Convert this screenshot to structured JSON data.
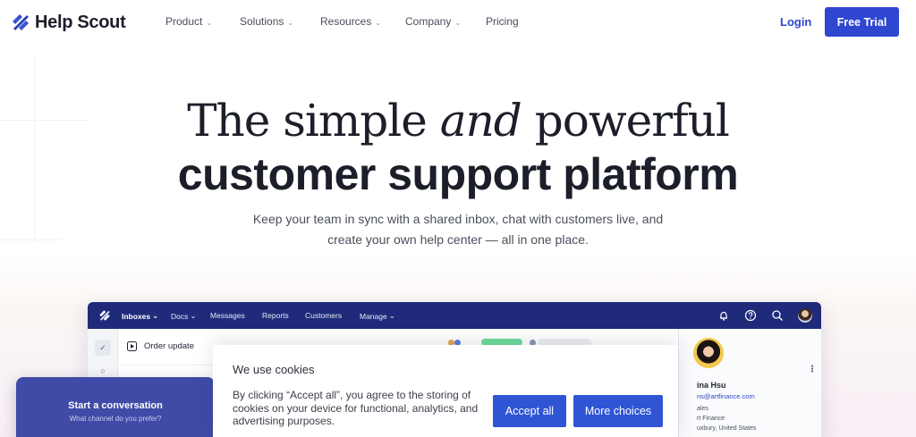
{
  "brand": {
    "name": "Help Scout",
    "accent": "#2f46d1",
    "nav_bar_color": "#1f2b7a"
  },
  "nav": {
    "items": [
      {
        "label": "Product",
        "has_dropdown": true
      },
      {
        "label": "Solutions",
        "has_dropdown": true
      },
      {
        "label": "Resources",
        "has_dropdown": true
      },
      {
        "label": "Company",
        "has_dropdown": true
      },
      {
        "label": "Pricing",
        "has_dropdown": false
      }
    ],
    "login_label": "Login",
    "cta_label": "Free Trial",
    "dropdown_icon": "chevron-down-icon"
  },
  "hero": {
    "line1_pre": "The simple ",
    "line1_em": "and",
    "line1_post": " powerful",
    "line2": "customer support platform",
    "subtitle": "Keep your team in sync with a shared inbox, chat with customers live, and create your own help center — all in one place."
  },
  "app": {
    "nav": [
      {
        "label": "Inboxes",
        "has_dropdown": true
      },
      {
        "label": "Docs",
        "has_dropdown": true
      },
      {
        "label": "Messages",
        "has_dropdown": false
      },
      {
        "label": "Reports",
        "has_dropdown": false
      },
      {
        "label": "Customers",
        "has_dropdown": false
      },
      {
        "label": "Manage",
        "has_dropdown": true
      }
    ],
    "icons": [
      "bell-icon",
      "help-icon",
      "search-icon",
      "user-avatar"
    ],
    "sidebar_icons": [
      "check-icon",
      "chat-bubble-icon"
    ],
    "conversation_title": "Order update",
    "profile": {
      "name": "ina Hsu",
      "email": "ns@artfinance.com",
      "lines": [
        "ales",
        "rt Finance",
        "uxbury, United States"
      ],
      "menu_icon": "more-vertical-icon"
    }
  },
  "chat": {
    "title": "Start a conversation",
    "subtitle": "What channel do you prefer?"
  },
  "cookie": {
    "title": "We use cookies",
    "text": "By clicking “Accept all”, you agree to the storing of cookies on your device for functional, analytics, and advertising purposes.",
    "accept_label": "Accept all",
    "more_label": "More choices"
  }
}
